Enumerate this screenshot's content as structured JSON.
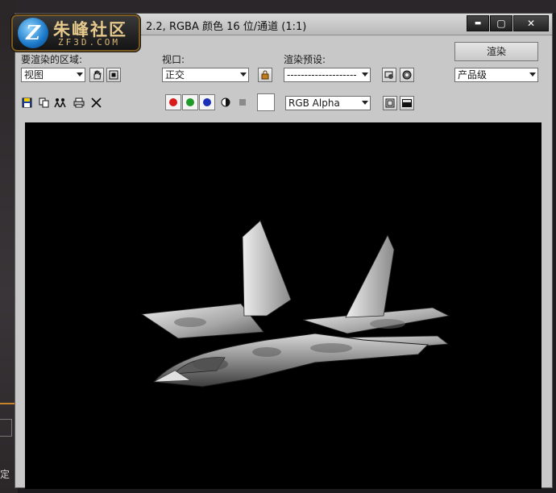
{
  "window": {
    "title": "2.2, RGBA 颜色 16 位/通道 (1:1)",
    "minimize_glyph": "▬",
    "maximize_glyph": "▢",
    "close_glyph": "✕"
  },
  "logo": {
    "letter": "Z",
    "main_text": "朱峰社区",
    "sub_text": "ZF3D.COM"
  },
  "controls": {
    "area_label": "要渲染的区域:",
    "area_value": "视图",
    "viewport_label": "视口:",
    "viewport_value": "正交",
    "preset_label": "渲染预设:",
    "preset_value": "--------------------",
    "render_button": "渲染",
    "quality_value": "产品级",
    "channel_value": "RGB Alpha"
  },
  "background": {
    "bottom_label": "定"
  },
  "colors": {
    "red_channel": "#d81b1b",
    "green_channel": "#1f9a2a",
    "blue_channel": "#1b2fb8",
    "viewport_bg": "#000000"
  },
  "icons": [
    "save-icon",
    "copy-icon",
    "clone-icon",
    "print-icon",
    "clear-icon",
    "lock-icon",
    "hand-icon",
    "region-icon",
    "render-setup-icon",
    "environment-icon",
    "alpha-icon",
    "mono-icon",
    "frame-icon",
    "display-icon"
  ]
}
